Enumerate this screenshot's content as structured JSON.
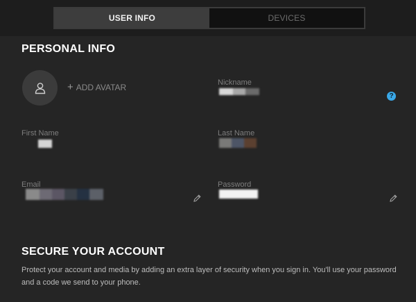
{
  "tabs": [
    {
      "label": "USER INFO",
      "active": true
    },
    {
      "label": "DEVICES",
      "active": false
    }
  ],
  "personal_info": {
    "title": "PERSONAL INFO",
    "avatar": {
      "icon": "user-icon",
      "add_label": "ADD AVATAR",
      "add_icon": "plus-icon"
    },
    "fields": {
      "nickname": {
        "label": "Nickname",
        "value_redacted": true,
        "help_icon": "help-icon"
      },
      "first_name": {
        "label": "First Name",
        "value_redacted": true
      },
      "last_name": {
        "label": "Last Name",
        "value_redacted": true
      },
      "email": {
        "label": "Email",
        "value_redacted": true,
        "edit_icon": "pencil-icon"
      },
      "password": {
        "label": "Password",
        "value_redacted": true,
        "edit_icon": "pencil-icon"
      }
    }
  },
  "secure_account": {
    "title": "SECURE YOUR ACCOUNT",
    "description": "Protect your account and media by adding an extra layer of security when you sign in. You'll use your password and a code we send to your phone."
  },
  "colors": {
    "background": "#252525",
    "topbar": "#1d1d1d",
    "active_tab": "#3d3d3d",
    "help_icon": "#3aa8e8"
  }
}
